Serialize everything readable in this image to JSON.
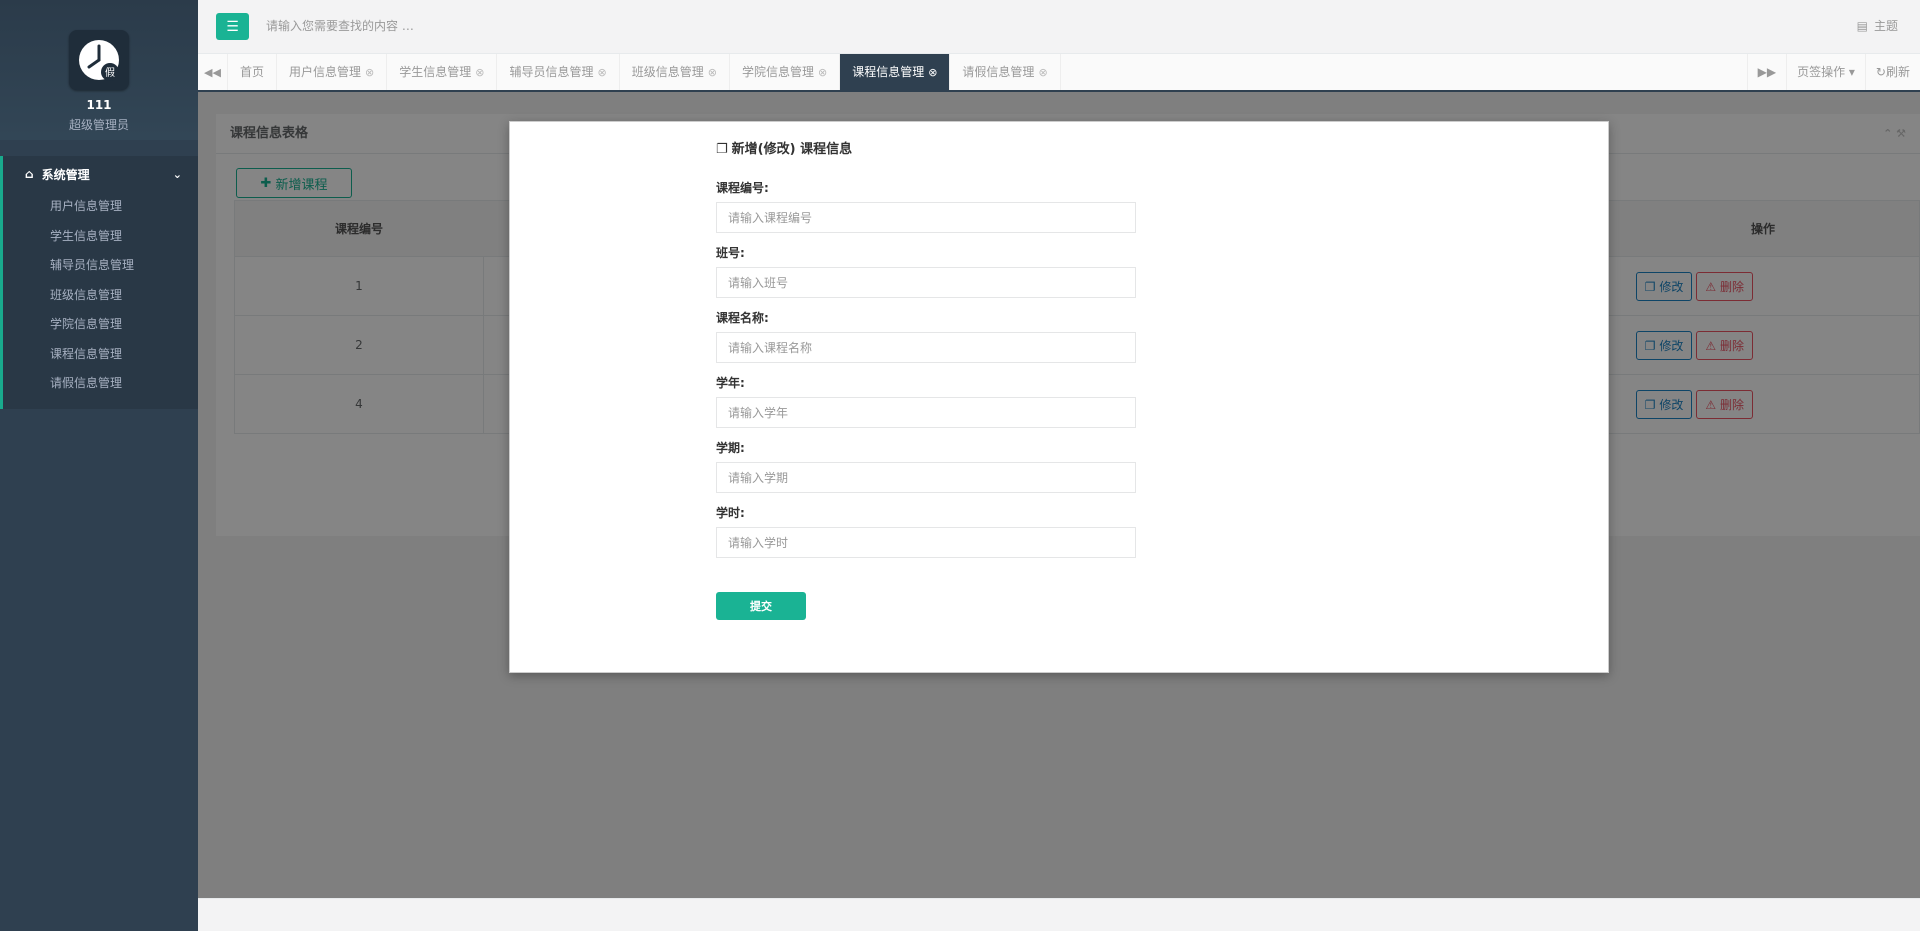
{
  "sidebar": {
    "user": {
      "name": "111",
      "role": "超级管理员",
      "logo_char": "假"
    },
    "menu_title": "系统管理",
    "items": [
      {
        "label": "用户信息管理"
      },
      {
        "label": "学生信息管理"
      },
      {
        "label": "辅导员信息管理"
      },
      {
        "label": "班级信息管理"
      },
      {
        "label": "学院信息管理"
      },
      {
        "label": "课程信息管理"
      },
      {
        "label": "请假信息管理"
      }
    ]
  },
  "topbar": {
    "search_placeholder": "请输入您需要查找的内容 …",
    "theme_label": "主题"
  },
  "tabs": [
    {
      "label": "首页"
    },
    {
      "label": "用户信息管理"
    },
    {
      "label": "学生信息管理"
    },
    {
      "label": "辅导员信息管理"
    },
    {
      "label": "班级信息管理"
    },
    {
      "label": "学院信息管理"
    },
    {
      "label": "课程信息管理"
    },
    {
      "label": "请假信息管理"
    }
  ],
  "tab_actions": {
    "tab_ops": "页签操作",
    "refresh": "刷新"
  },
  "panel": {
    "title": "课程信息表格",
    "add_button": "新增课程",
    "columns": {
      "id": "课程编号",
      "ops": "操作"
    },
    "rows": [
      {
        "id": "1"
      },
      {
        "id": "2"
      },
      {
        "id": "4"
      }
    ],
    "edit_label": "修改",
    "delete_label": "删除"
  },
  "modal": {
    "title": "新增(修改) 课程信息",
    "fields": [
      {
        "label": "课程编号:",
        "placeholder": "请输入课程编号"
      },
      {
        "label": "班号:",
        "placeholder": "请输入班号"
      },
      {
        "label": "课程名称:",
        "placeholder": "请输入课程名称"
      },
      {
        "label": "学年:",
        "placeholder": "请输入学年"
      },
      {
        "label": "学期:",
        "placeholder": "请输入学期"
      },
      {
        "label": "学时:",
        "placeholder": "请输入学时"
      }
    ],
    "submit_label": "提交"
  },
  "colors": {
    "accent": "#1ab394",
    "sidebar": "#2f4050",
    "edit": "#1c84c6",
    "delete": "#ed5565"
  },
  "icons": [
    "bars-icon",
    "home-icon",
    "chevron-down-icon",
    "backward-icon",
    "forward-icon",
    "close-circle-icon",
    "refresh-icon",
    "theme-icon",
    "plus-icon",
    "copy-icon",
    "warning-icon",
    "clock-logo-icon"
  ]
}
